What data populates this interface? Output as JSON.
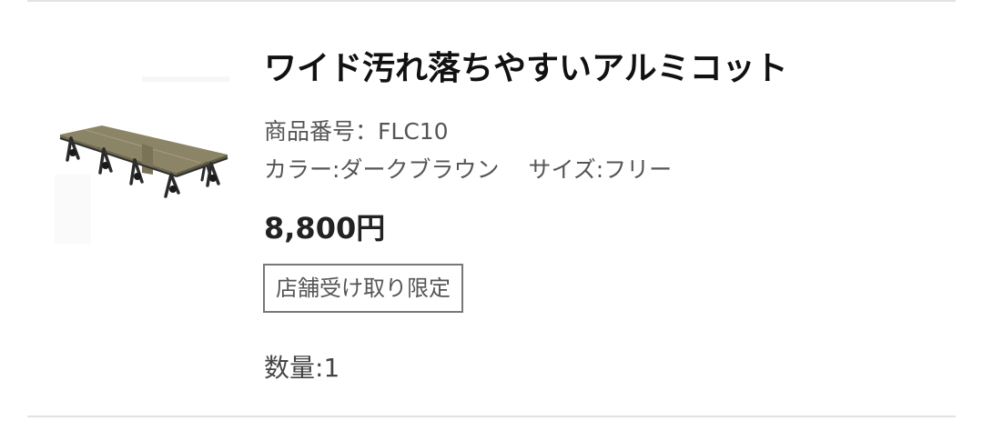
{
  "product": {
    "name": "ワイド汚れ落ちやすいアルミコット",
    "code_label": "商品番号：",
    "code": "FLC10",
    "color_label": "カラー:",
    "color": "ダークブラウン",
    "size_label": "サイズ:",
    "size": "フリー",
    "price": "8,800円",
    "badge": "店舗受け取り限定",
    "quantity_label": "数量:",
    "quantity": "1",
    "image_icon": "cot-product-image"
  },
  "colors": {
    "divider": "#e2e2e2",
    "badge_border": "#777777",
    "cot_fabric": "#8c8466",
    "cot_frame": "#2b2b2b"
  }
}
